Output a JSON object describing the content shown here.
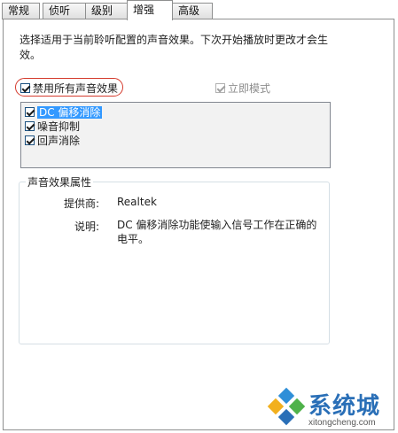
{
  "tabs": [
    {
      "label": "常规",
      "active": false
    },
    {
      "label": "侦听",
      "active": false
    },
    {
      "label": "级别",
      "active": false
    },
    {
      "label": "增强",
      "active": true
    },
    {
      "label": "高级",
      "active": false
    }
  ],
  "description": "选择适用于当前聆听配置的声音效果。下次开始播放时更改才会生效。",
  "disable_all": {
    "label": "禁用所有声音效果",
    "checked": true
  },
  "immediate_mode": {
    "label": "立即模式",
    "checked": true,
    "disabled": true
  },
  "effects": [
    {
      "label": "DC 偏移消除",
      "checked": true,
      "selected": true
    },
    {
      "label": "噪音抑制",
      "checked": true,
      "selected": false
    },
    {
      "label": "回声消除",
      "checked": true,
      "selected": false
    }
  ],
  "properties": {
    "title": "声音效果属性",
    "provider_label": "提供商:",
    "provider_value": "Realtek",
    "description_label": "说明:",
    "description_value": "DC 偏移消除功能使输入信号工作在正确的电平。"
  },
  "watermark": {
    "brand": "系统城",
    "url": "xitongcheng.com",
    "icon": "windows-logo-icon"
  },
  "colors": {
    "accent_selected": "#3399ff",
    "highlight_ring": "#d43a2c",
    "brand_blue": "#2a6fb7"
  }
}
